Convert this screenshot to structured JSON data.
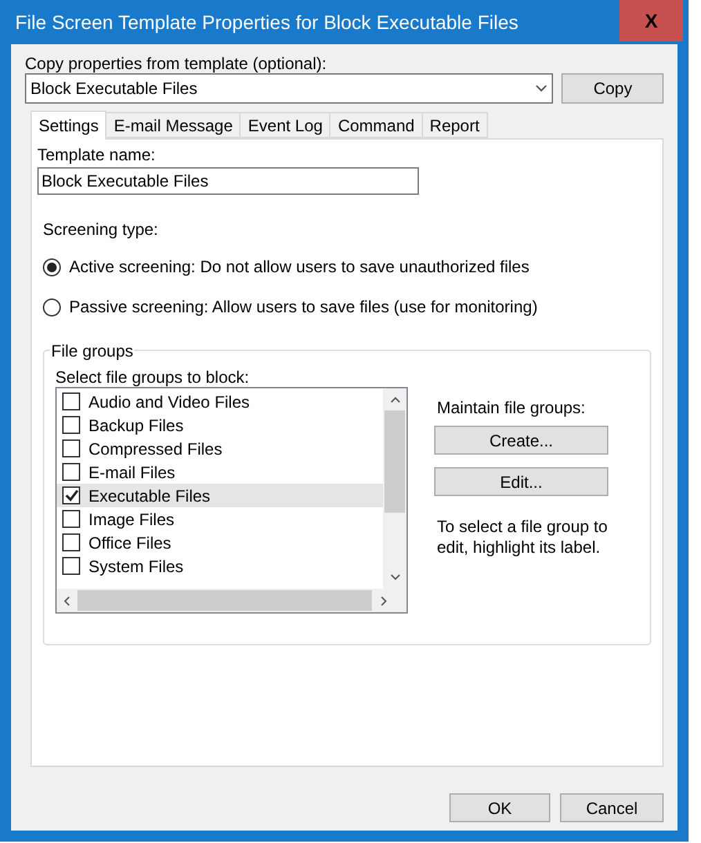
{
  "window": {
    "title": "File Screen Template Properties for Block Executable Files",
    "close": "X"
  },
  "copy_from": {
    "label": "Copy properties from template (optional):",
    "value": "Block Executable Files",
    "button": "Copy"
  },
  "tabs": [
    {
      "label": "Settings",
      "selected": true
    },
    {
      "label": "E-mail Message",
      "selected": false
    },
    {
      "label": "Event Log",
      "selected": false
    },
    {
      "label": "Command",
      "selected": false
    },
    {
      "label": "Report",
      "selected": false
    }
  ],
  "template_name": {
    "label": "Template name:",
    "value": "Block Executable Files"
  },
  "screening_type": {
    "label": "Screening type:",
    "options": [
      {
        "label": "Active screening: Do not allow users to save unauthorized files",
        "selected": true
      },
      {
        "label": "Passive screening: Allow users to save files (use for monitoring)",
        "selected": false
      }
    ]
  },
  "file_groups": {
    "title": "File groups",
    "list_label": "Select file groups to block:",
    "items": [
      {
        "label": "Audio and Video Files",
        "checked": false,
        "selected": false
      },
      {
        "label": "Backup Files",
        "checked": false,
        "selected": false
      },
      {
        "label": "Compressed Files",
        "checked": false,
        "selected": false
      },
      {
        "label": "E-mail Files",
        "checked": false,
        "selected": false
      },
      {
        "label": "Executable Files",
        "checked": true,
        "selected": true
      },
      {
        "label": "Image Files",
        "checked": false,
        "selected": false
      },
      {
        "label": "Office Files",
        "checked": false,
        "selected": false
      },
      {
        "label": "System Files",
        "checked": false,
        "selected": false
      }
    ],
    "maintain_label": "Maintain file groups:",
    "buttons": [
      "Create...",
      "Edit..."
    ],
    "hint": "To select a file group to edit, highlight its label."
  },
  "buttons": [
    "OK",
    "Cancel"
  ]
}
